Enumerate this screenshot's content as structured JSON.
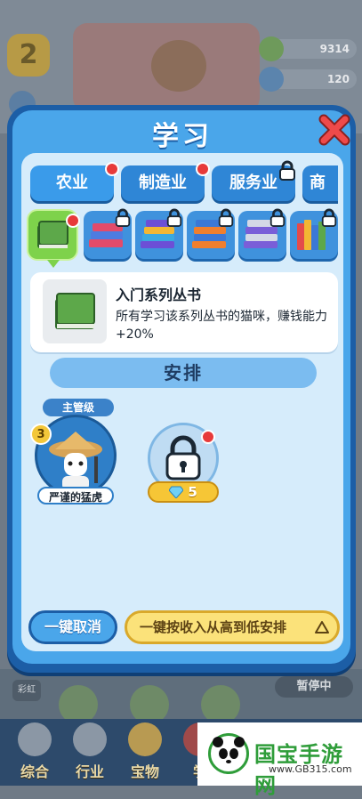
{
  "background": {
    "level": "2",
    "resources": [
      {
        "value": "9314",
        "color": "#5fa04a"
      },
      {
        "value": "120",
        "color": "#3f7fc4"
      }
    ],
    "left_tab": "彩虹",
    "pause_label": "暂停中",
    "nav": [
      "综合",
      "行业",
      "宝物",
      "学"
    ]
  },
  "modal": {
    "title": "学习",
    "tabs": [
      {
        "label": "农业",
        "badge": true,
        "locked": false
      },
      {
        "label": "制造业",
        "badge": true,
        "locked": false
      },
      {
        "label": "服务业",
        "badge": false,
        "locked": true
      },
      {
        "label": "商",
        "badge": false,
        "locked": false
      }
    ],
    "books": [
      {
        "name": "green-book",
        "selected": true,
        "locked": false,
        "badge": true
      },
      {
        "name": "book-stack-red",
        "locked": true
      },
      {
        "name": "book-stack-mixed",
        "locked": true
      },
      {
        "name": "book-stack-orange",
        "locked": true
      },
      {
        "name": "book-stack-purple",
        "locked": true
      },
      {
        "name": "books-upright",
        "locked": true
      }
    ],
    "info": {
      "title": "入门系列丛书",
      "description": "所有学习该系列丛书的猫咪，赚钱能力+20%"
    },
    "arrange_label": "安排",
    "cat": {
      "rank": "主管级",
      "level": "3",
      "name": "严谨的猛虎"
    },
    "locked_slot": {
      "cost": "5"
    },
    "buttons": {
      "cancel": "一键取消",
      "auto": "一键按收入从高到低安排"
    }
  },
  "watermark": {
    "title": "国宝手游网",
    "url": "www.GB315.com"
  }
}
